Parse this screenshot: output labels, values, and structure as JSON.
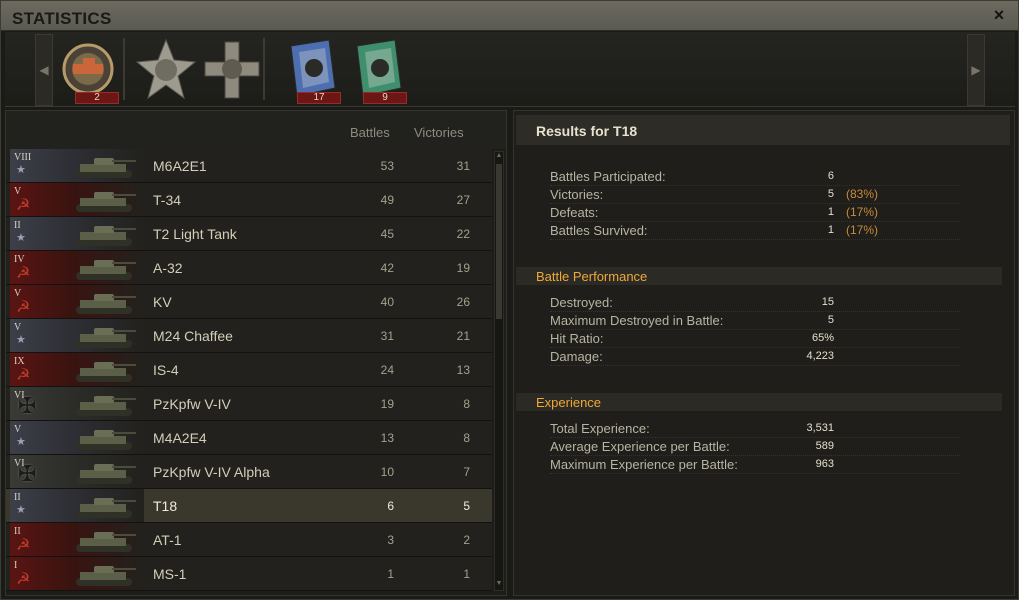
{
  "window": {
    "title": "STATISTICS",
    "close_label": "×"
  },
  "medals": [
    {
      "name": "tank-badge-medal",
      "count": "2",
      "color": "#b89b6a"
    },
    {
      "name": "star-medal",
      "count": "",
      "color": "#9d9a8e"
    },
    {
      "name": "cross-medal",
      "count": "",
      "color": "#8f8a7e"
    },
    {
      "name": "ribbon-badge-blue",
      "count": "17",
      "color": "#4d6fb2"
    },
    {
      "name": "ribbon-badge-green",
      "count": "9",
      "color": "#3f8f6e"
    }
  ],
  "list": {
    "headers": {
      "battles": "Battles",
      "victories": "Victories"
    },
    "rows": [
      {
        "tier": "VIII",
        "nation": "usa",
        "name": "M6A2E1",
        "battles": "53",
        "victories": "31"
      },
      {
        "tier": "V",
        "nation": "ussr",
        "name": "T-34",
        "battles": "49",
        "victories": "27"
      },
      {
        "tier": "II",
        "nation": "usa",
        "name": "T2 Light Tank",
        "battles": "45",
        "victories": "22"
      },
      {
        "tier": "IV",
        "nation": "ussr",
        "name": "A-32",
        "battles": "42",
        "victories": "19"
      },
      {
        "tier": "V",
        "nation": "ussr",
        "name": "KV",
        "battles": "40",
        "victories": "26"
      },
      {
        "tier": "V",
        "nation": "usa",
        "name": "M24 Chaffee",
        "battles": "31",
        "victories": "21"
      },
      {
        "tier": "IX",
        "nation": "ussr",
        "name": "IS-4",
        "battles": "24",
        "victories": "13"
      },
      {
        "tier": "VI",
        "nation": "ger",
        "name": "PzKpfw V-IV",
        "battles": "19",
        "victories": "8"
      },
      {
        "tier": "V",
        "nation": "usa",
        "name": "M4A2E4",
        "battles": "13",
        "victories": "8"
      },
      {
        "tier": "VI",
        "nation": "ger",
        "name": "PzKpfw V-IV Alpha",
        "battles": "10",
        "victories": "7"
      },
      {
        "tier": "II",
        "nation": "usa",
        "name": "T18",
        "battles": "6",
        "victories": "5",
        "selected": true
      },
      {
        "tier": "II",
        "nation": "ussr",
        "name": "AT-1",
        "battles": "3",
        "victories": "2"
      },
      {
        "tier": "I",
        "nation": "ussr",
        "name": "MS-1",
        "battles": "1",
        "victories": "1"
      }
    ]
  },
  "results": {
    "title": "Results for T18",
    "general": [
      {
        "label": "Battles Participated:",
        "value": "6",
        "pct": ""
      },
      {
        "label": "Victories:",
        "value": "5",
        "pct": "(83%)"
      },
      {
        "label": "Defeats:",
        "value": "1",
        "pct": "(17%)"
      },
      {
        "label": "Battles Survived:",
        "value": "1",
        "pct": "(17%)"
      }
    ],
    "performance_header": "Battle Performance",
    "performance": [
      {
        "label": "Destroyed:",
        "value": "15"
      },
      {
        "label": "Maximum Destroyed in Battle:",
        "value": "5"
      },
      {
        "label": "Hit Ratio:",
        "value": "65%"
      },
      {
        "label": "Damage:",
        "value": "4,223"
      }
    ],
    "experience_header": "Experience",
    "experience": [
      {
        "label": "Total Experience:",
        "value": "3,531"
      },
      {
        "label": "Average Experience per Battle:",
        "value": "589"
      },
      {
        "label": "Maximum Experience per Battle:",
        "value": "963"
      }
    ]
  }
}
